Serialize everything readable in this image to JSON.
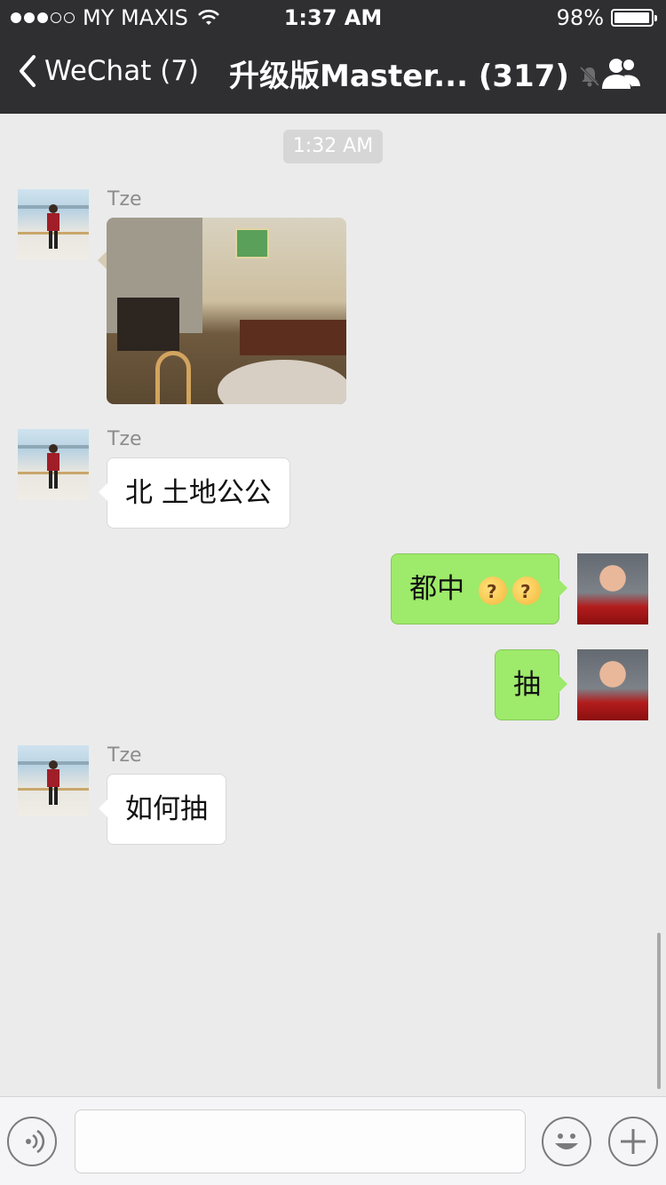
{
  "status_bar": {
    "carrier": "MY MAXIS",
    "time": "1:37 AM",
    "battery": "98%",
    "battery_level": 0.98,
    "signal_bars": 3
  },
  "nav": {
    "back_label": "WeChat (7)",
    "title": "升级版Master... (317)"
  },
  "chat": {
    "timestamp": "1:32 AM",
    "messages": [
      {
        "sender": "Tze",
        "direction": "in",
        "type": "image"
      },
      {
        "sender": "Tze",
        "direction": "in",
        "type": "text",
        "text": "北 土地公公"
      },
      {
        "sender": "me",
        "direction": "out",
        "type": "text",
        "text": "都中"
      },
      {
        "sender": "me",
        "direction": "out",
        "type": "text",
        "text": "抽"
      },
      {
        "sender": "Tze",
        "direction": "in",
        "type": "text",
        "text": "如何抽"
      }
    ]
  },
  "input_bar": {
    "input_value": "",
    "icons": [
      "voice-icon",
      "emoji-icon",
      "plus-icon"
    ]
  },
  "colors": {
    "header_bg": "#2f2f32",
    "chat_bg": "#ebebeb",
    "outgoing_bubble": "#9eea6a",
    "incoming_bubble": "#ffffff"
  }
}
